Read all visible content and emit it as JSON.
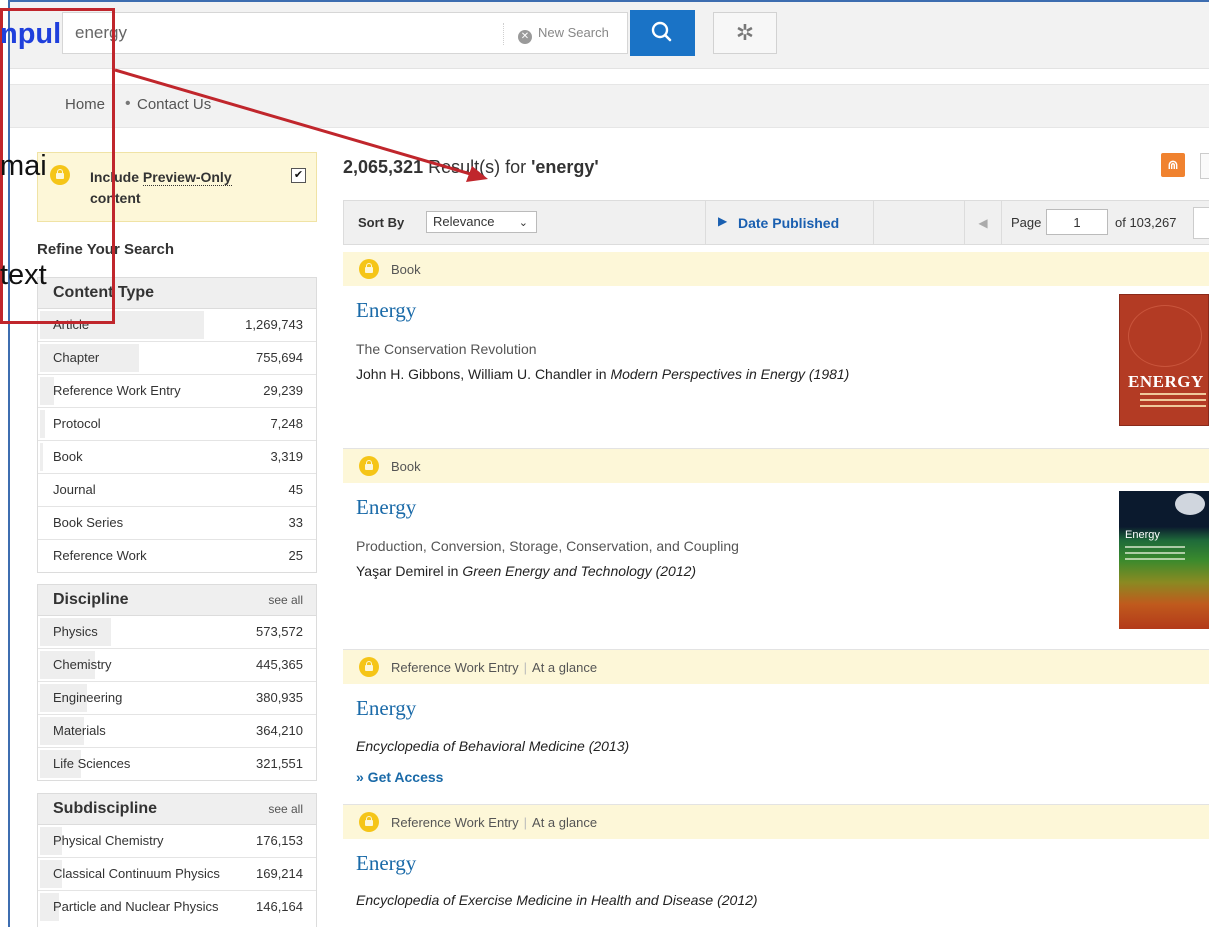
{
  "header": {
    "search_value": "energy",
    "new_search_label": "New Search"
  },
  "nav": {
    "home": "Home",
    "separator": "•",
    "contact": "Contact Us"
  },
  "sidebar": {
    "preview_label_part1": "Include",
    "preview_label_part2": "Preview-Only",
    "preview_label_part3": "content",
    "preview_checked": true,
    "refine_title": "Refine Your Search",
    "content_type": {
      "title": "Content Type",
      "rows": [
        {
          "name": "Article",
          "count": "1,269,743",
          "share": 0.6
        },
        {
          "name": "Chapter",
          "count": "755,694",
          "share": 0.36
        },
        {
          "name": "Reference Work Entry",
          "count": "29,239",
          "share": 0.05
        },
        {
          "name": "Protocol",
          "count": "7,248",
          "share": 0.02
        },
        {
          "name": "Book",
          "count": "3,319",
          "share": 0.01
        },
        {
          "name": "Journal",
          "count": "45",
          "share": 0
        },
        {
          "name": "Book Series",
          "count": "33",
          "share": 0
        },
        {
          "name": "Reference Work",
          "count": "25",
          "share": 0
        }
      ]
    },
    "discipline": {
      "title": "Discipline",
      "see_all": "see all",
      "rows": [
        {
          "name": "Physics",
          "count": "573,572",
          "share": 0.26
        },
        {
          "name": "Chemistry",
          "count": "445,365",
          "share": 0.2
        },
        {
          "name": "Engineering",
          "count": "380,935",
          "share": 0.17
        },
        {
          "name": "Materials",
          "count": "364,210",
          "share": 0.16
        },
        {
          "name": "Life Sciences",
          "count": "321,551",
          "share": 0.15
        }
      ]
    },
    "subdiscipline": {
      "title": "Subdiscipline",
      "see_all": "see all",
      "rows": [
        {
          "name": "Physical Chemistry",
          "count": "176,153",
          "share": 0.08
        },
        {
          "name": "Classical Continuum Physics",
          "count": "169,214",
          "share": 0.08
        },
        {
          "name": "Particle and Nuclear Physics",
          "count": "146,164",
          "share": 0.07
        }
      ]
    }
  },
  "annotation": {
    "line1": "npul",
    "line2": "mai",
    "line3": "text"
  },
  "results": {
    "count": "2,065,321",
    "label": "Result(s) for",
    "query": "'energy'",
    "sort_label": "Sort By",
    "sort_value": "Relevance",
    "date_sort_label": "Date Published",
    "page_label": "Page",
    "page_value": "1",
    "page_total": "of 103,267",
    "items": [
      {
        "type": "Book",
        "title": "Energy",
        "subtitle": "The Conservation Revolution",
        "authors": "John H. Gibbons, William U. Chandler in",
        "source": "Modern Perspectives in Energy (1981)",
        "cover_title": "ENERGY"
      },
      {
        "type": "Book",
        "title": "Energy",
        "subtitle": "Production, Conversion, Storage, Conservation, and Coupling",
        "authors": "Yaşar Demirel in",
        "source": "Green Energy and Technology (2012)",
        "cover_title": "Energy"
      },
      {
        "type": "Reference Work Entry",
        "glance": "At a glance",
        "title": "Energy",
        "source": "Encyclopedia of Behavioral Medicine (2013)",
        "get_access": "» Get Access"
      },
      {
        "type": "Reference Work Entry",
        "glance": "At a glance",
        "title": "Energy",
        "source": "Encyclopedia of Exercise Medicine in Health and Disease (2012)"
      }
    ]
  },
  "colors": {
    "accent": "#1a73c6",
    "annotation_red": "#c0262c",
    "annotation_blue": "#1f3fdc",
    "preview_bg": "#fdf7d8"
  },
  "icons": [
    "search-icon",
    "gear-icon",
    "clear-icon",
    "lock-icon",
    "rss-icon",
    "chevron-down-icon",
    "triangle-right-icon",
    "chevron-left-icon"
  ]
}
